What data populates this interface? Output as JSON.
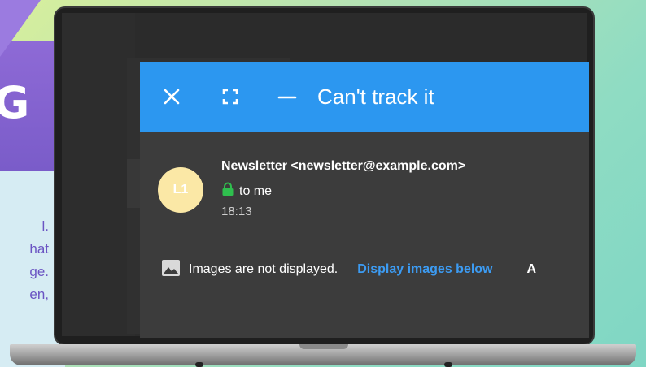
{
  "background_slide": {
    "heading_fragment": "G",
    "text_lines": [
      "l.",
      "hat",
      "ge.",
      "en,"
    ]
  },
  "dialog": {
    "title": "Can't track it",
    "header_color": "#2c97f0",
    "controls": [
      "close-icon",
      "fullscreen-icon",
      "minimize-icon"
    ]
  },
  "message": {
    "avatar_initials": "L1",
    "avatar_color": "#fbe8a6",
    "sender": "Newsletter <newsletter@example.com>",
    "recipient": "to me",
    "recipient_icon": "lock-icon",
    "time": "18:13"
  },
  "images_bar": {
    "icon": "image-icon",
    "notice": "Images are not displayed.",
    "link": "Display images below",
    "link_color": "#3c9bf2",
    "overflow": "A"
  }
}
